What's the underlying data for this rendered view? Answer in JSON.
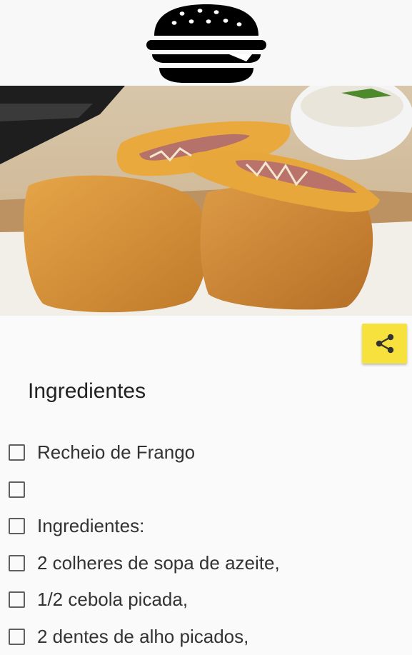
{
  "header": {
    "logo_icon": "burger-icon"
  },
  "hero": {
    "image_subject": "fried-chicken-pastry-photo"
  },
  "actions": {
    "share_icon": "share-icon",
    "share_color": "#f7e23d"
  },
  "section": {
    "title": "Ingredientes"
  },
  "ingredients": [
    {
      "label": "Recheio de Frango",
      "checked": false
    },
    {
      "label": "",
      "checked": false
    },
    {
      "label": "Ingredientes:",
      "checked": false
    },
    {
      "label": "2 colheres de sopa de azeite,",
      "checked": false
    },
    {
      "label": "1/2 cebola picada,",
      "checked": false
    },
    {
      "label": "2 dentes de alho picados,",
      "checked": false
    }
  ]
}
